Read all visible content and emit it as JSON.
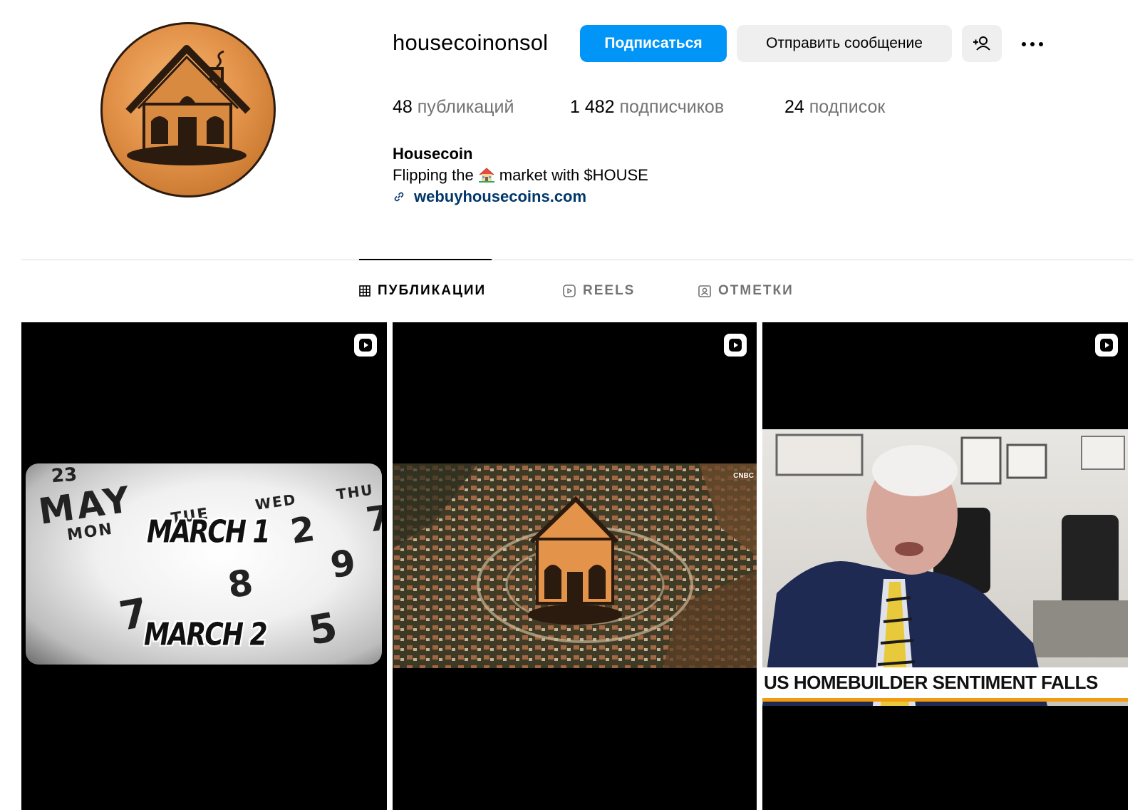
{
  "profile": {
    "username": "housecoinonsol",
    "follow_label": "Подписаться",
    "message_label": "Отправить сообщение",
    "stats": {
      "posts_count": "48",
      "posts_label": "публикаций",
      "followers_count": "1 482",
      "followers_label": "подписчиков",
      "following_count": "24",
      "following_label": "подписок"
    },
    "bio": {
      "name": "Housecoin",
      "text_before": "Flipping the",
      "text_after": "market with $HOUSE",
      "emoji": "house-emoji",
      "link": "webuyhousecoins.com"
    }
  },
  "tabs": [
    {
      "label": "ПУБЛИКАЦИИ",
      "icon": "grid-icon",
      "active": true
    },
    {
      "label": "REELS",
      "icon": "reels-icon",
      "active": false
    },
    {
      "label": "ОТМЕТКИ",
      "icon": "tagged-icon",
      "active": false
    }
  ],
  "posts": [
    {
      "type": "reel",
      "calendar": {
        "month": "MAY",
        "days": [
          "MON",
          "TUE",
          "WED",
          "THU"
        ],
        "numbers": [
          "23",
          "2",
          "7",
          "8",
          "9",
          "5"
        ]
      },
      "overlay_1": "MARCH 1",
      "overlay_2": "MARCH 2"
    },
    {
      "type": "reel",
      "channel": "CNBC"
    },
    {
      "type": "reel",
      "headline": "US HOMEBUILDER SENTIMENT FALLS"
    }
  ],
  "colors": {
    "follow_button": "#0095f6",
    "secondary_button": "#efefef",
    "link": "#00376b",
    "muted_text": "#737373",
    "ticker_accent": "#f39c12"
  }
}
